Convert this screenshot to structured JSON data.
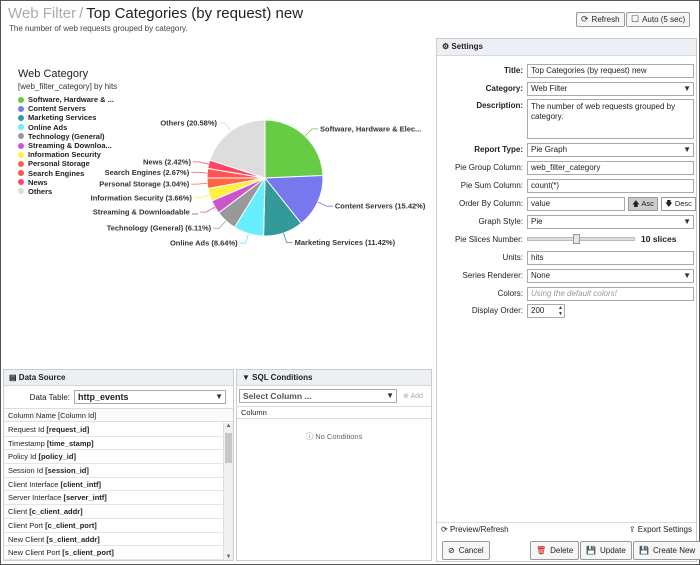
{
  "header": {
    "crumb": "Web Filter",
    "separator": "/",
    "title": "Top Categories (by request) new",
    "subtitle": "The number of web requests grouped by category.",
    "refresh_label": "Refresh",
    "auto_label": "Auto (5 sec)"
  },
  "chart": {
    "legend_title": "Web Category",
    "legend_subtitle": "[web_filter_category] by hits"
  },
  "chart_data": {
    "type": "pie",
    "title": "Web Category",
    "subtitle": "[web_filter_category] by hits",
    "legend_placement": "top-left",
    "slices": [
      {
        "label": "Software, Hardware & Elec...",
        "legend": "Software, Hardware & ...",
        "value": 25.0,
        "color": "#66cc44"
      },
      {
        "label": "Content Servers (15.42%)",
        "legend": "Content Servers",
        "value": 15.42,
        "color": "#7777ee"
      },
      {
        "label": "Marketing Services (11.42%)",
        "legend": "Marketing Services",
        "value": 11.42,
        "color": "#339999"
      },
      {
        "label": "Online Ads (8.64%)",
        "legend": "Online Ads",
        "value": 8.64,
        "color": "#66eeff"
      },
      {
        "label": "Technology (General) (6.11%)",
        "legend": "Technology (General)",
        "value": 6.11,
        "color": "#999999"
      },
      {
        "label": "Streaming & Downloadable ...",
        "legend": "Streaming & Downloa...",
        "value": 3.9,
        "color": "#cc55cc"
      },
      {
        "label": "Information Security (3.66%)",
        "legend": "Information Security",
        "value": 3.66,
        "color": "#ffee44"
      },
      {
        "label": "Personal Storage (3.04%)",
        "legend": "Personal Storage",
        "value": 3.04,
        "color": "#ff6644"
      },
      {
        "label": "Search Engines (2.67%)",
        "legend": "Search Engines",
        "value": 2.67,
        "color": "#ff5555"
      },
      {
        "label": "News (2.42%)",
        "legend": "News",
        "value": 2.42,
        "color": "#ff4466"
      },
      {
        "label": "Others (20.58%)",
        "legend": "Others",
        "value": 20.58,
        "color": "#dddddd"
      }
    ]
  },
  "data_source": {
    "title": "Data Source",
    "data_table_label": "Data Table:",
    "data_table_value": "http_events",
    "column_header": "Column Name [Column Id]",
    "columns": [
      {
        "name": "Request Id",
        "id": "[request_id]"
      },
      {
        "name": "Timestamp",
        "id": "[time_stamp]"
      },
      {
        "name": "Policy Id",
        "id": "[policy_id]"
      },
      {
        "name": "Session Id",
        "id": "[session_id]"
      },
      {
        "name": "Client Interface",
        "id": "[client_intf]"
      },
      {
        "name": "Server Interface",
        "id": "[server_intf]"
      },
      {
        "name": "Client",
        "id": "[c_client_addr]"
      },
      {
        "name": "Client Port",
        "id": "[c_client_port]"
      },
      {
        "name": "New Client",
        "id": "[s_client_addr]"
      },
      {
        "name": "New Client Port",
        "id": "[s_client_port]"
      }
    ]
  },
  "sql": {
    "title": "SQL Conditions",
    "select_placeholder": "Select Column ...",
    "add_label": "Add",
    "column_header": "Column",
    "empty_text": "No Conditions"
  },
  "settings": {
    "title": "Settings",
    "title_label": "Title:",
    "title_value": "Top Categories (by request) new",
    "category_label": "Category:",
    "category_value": "Web Filter",
    "description_label": "Description:",
    "description_value": "The number of web requests grouped by category.",
    "report_type_label": "Report Type:",
    "report_type_value": "Pie Graph",
    "group_col_label": "Pie Group Column:",
    "group_col_value": "web_filter_category",
    "sum_col_label": "Pie Sum Column:",
    "sum_col_value": "count(*)",
    "order_label": "Order By Column:",
    "order_value": "value",
    "asc_label": "Asc",
    "desc_label": "Desc",
    "graph_style_label": "Graph Style:",
    "graph_style_value": "Pie",
    "slices_label": "Pie Slices Number:",
    "slices_value": "10 slices",
    "slices_fraction": 0.45,
    "units_label": "Units:",
    "units_value": "hits",
    "renderer_label": "Series Renderer:",
    "renderer_value": "None",
    "colors_label": "Colors:",
    "colors_placeholder": "Using the default colors!",
    "display_order_label": "Display Order:",
    "display_order_value": "200",
    "preview_label": "Preview/Refresh",
    "export_label": "Export Settings",
    "cancel_label": "Cancel",
    "delete_label": "Delete",
    "update_label": "Update",
    "create_label": "Create New"
  }
}
